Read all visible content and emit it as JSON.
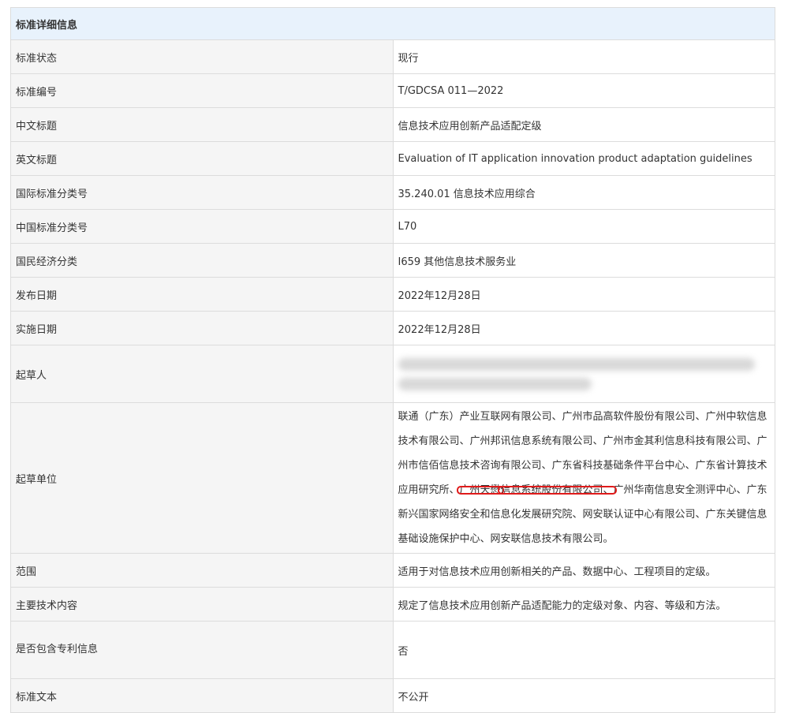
{
  "table": {
    "header": "标准详细信息",
    "rows": [
      {
        "label": "标准状态",
        "value": "现行"
      },
      {
        "label": "标准编号",
        "value": "T/GDCSA 011—2022"
      },
      {
        "label": "中文标题",
        "value": "信息技术应用创新产品适配定级"
      },
      {
        "label": "英文标题",
        "value": "Evaluation of IT application innovation product adaptation guidelines"
      },
      {
        "label": "国际标准分类号",
        "value": "35.240.01 信息技术应用综合"
      },
      {
        "label": "中国标准分类号",
        "value": "L70"
      },
      {
        "label": "国民经济分类",
        "value": "I659 其他信息技术服务业"
      },
      {
        "label": "发布日期",
        "value": "2022年12月28日"
      },
      {
        "label": "实施日期",
        "value": "2022年12月28日"
      }
    ],
    "drafter": {
      "label": "起草人",
      "value_redacted": true
    },
    "drafting_unit": {
      "label": "起草单位",
      "before": "联通（广东）产业互联网有限公司、广州市品高软件股份有限公司、广州中软信息技术有限公司、广州邦讯信息系统有限公司、广州市金其利信息科技有限公司、广州市信佰信息技术咨询有限公司、广东省科技基础条件平台中心、广东省计算技术应用研究所、",
      "highlight_1": "广州天懋",
      "highlight_2": "信息系统股份有限公司、",
      "after": "广州华南信息安全测评中心、广东新兴国家网络安全和信息化发展研究院、网安联认证中心有限公司、广东关键信息基础设施保护中心、网安联信息技术有限公司。"
    },
    "rows2": [
      {
        "label": "范围",
        "value": "适用于对信息技术应用创新相关的产品、数据中心、工程项目的定级。"
      },
      {
        "label": "主要技术内容",
        "value": "规定了信息技术应用创新产品适配能力的定级对象、内容、等级和方法。"
      }
    ],
    "patent": {
      "label": "是否包含专利信息",
      "value": "否"
    },
    "text_row": {
      "label": "标准文本",
      "value": "不公开"
    }
  },
  "colors": {
    "header_bg": "#e8f2fc",
    "label_bg": "#f5f5f5",
    "border": "#dcdcdc",
    "highlight": "#e01b1b"
  }
}
